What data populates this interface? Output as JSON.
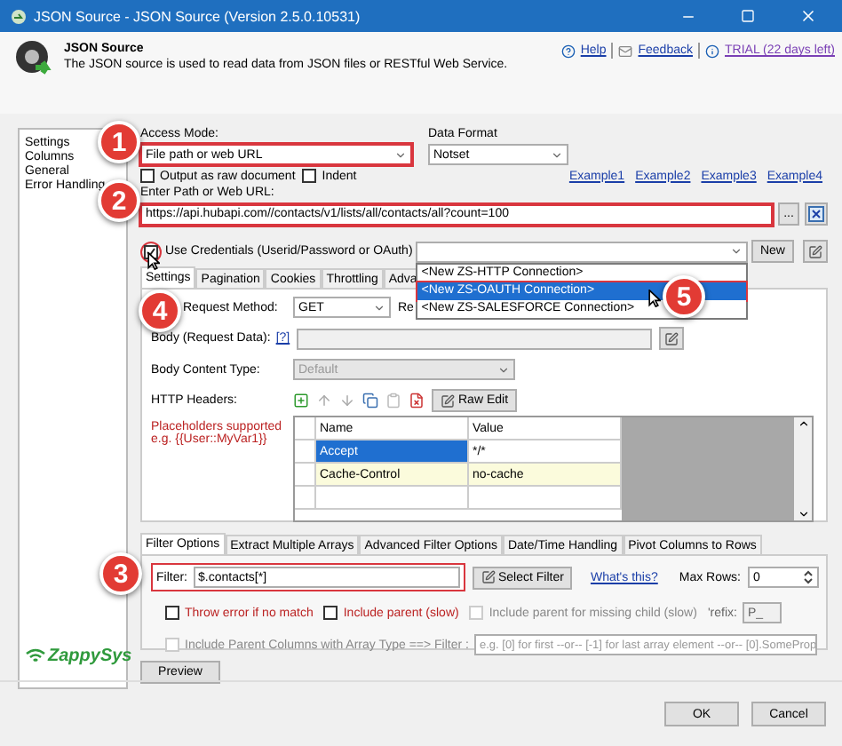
{
  "window": {
    "title": "JSON Source - JSON Source (Version 2.5.0.10531)"
  },
  "header": {
    "title": "JSON Source",
    "description": "The JSON source is used to read data from JSON files or RESTful Web Service.",
    "links": [
      {
        "label": "Help",
        "kind": "help"
      },
      {
        "label": "Feedback",
        "kind": "feedback"
      },
      {
        "label": "TRIAL (22 days left)",
        "kind": "trial"
      }
    ]
  },
  "sidebar": {
    "items": [
      "Settings",
      "Columns",
      "General",
      "Error Handling"
    ],
    "logo": "ZappySys"
  },
  "access_mode": {
    "label": "Access Mode:",
    "value": "File path or web URL",
    "highlighted": true
  },
  "data_format": {
    "label": "Data Format",
    "value": "Notset"
  },
  "options": [
    {
      "label": "Output as raw document",
      "checked": false
    },
    {
      "label": "Indent",
      "checked": false
    }
  ],
  "examples": [
    "Example1",
    "Example2",
    "Example3",
    "Example4"
  ],
  "url": {
    "label": "Enter Path or Web URL:",
    "value": "https://api.hubapi.com//contacts/v1/lists/all/contacts/all?count=100",
    "highlighted": true,
    "browse": "..."
  },
  "credentials": {
    "label": "Use Credentials (Userid/Password or OAuth)",
    "checked": true,
    "highlighted": true,
    "new_button": "New",
    "expanded": true,
    "options": [
      {
        "label": "<New ZS-HTTP Connection>",
        "selected": false
      },
      {
        "label": "<New ZS-OAUTH Connection>",
        "selected": true
      },
      {
        "label": "<New ZS-SALESFORCE Connection>",
        "selected": false
      }
    ]
  },
  "request_tabs": [
    {
      "label": "Settings",
      "selected": true
    },
    {
      "label": "Pagination",
      "selected": false
    },
    {
      "label": "Cookies",
      "selected": false
    },
    {
      "label": "Throttling",
      "selected": false
    },
    {
      "label": "Adva",
      "selected": false
    }
  ],
  "request": {
    "method_label": "Request Method:",
    "method": "GET",
    "cut_label": "Re",
    "body_label": "Body (Request Data):",
    "help": "[?]",
    "content_type_label": "Body Content Type:",
    "content_type": "Default",
    "headers_label": "HTTP Headers:",
    "raw_edit": "Raw Edit",
    "hint": "Placeholders supported e.g. {{User::MyVar1}}",
    "columns": [
      "Name",
      "Value"
    ],
    "rows": [
      {
        "name": "Accept",
        "value": "*/*",
        "selected": true
      },
      {
        "name": "Cache-Control",
        "value": "no-cache",
        "selected": false
      }
    ]
  },
  "filter_tabs": [
    {
      "label": "Filter Options",
      "selected": true
    },
    {
      "label": "Extract Multiple Arrays",
      "selected": false
    },
    {
      "label": "Advanced Filter Options",
      "selected": false
    },
    {
      "label": "Date/Time Handling",
      "selected": false
    },
    {
      "label": "Pivot Columns to Rows",
      "selected": false
    }
  ],
  "filter": {
    "label": "Filter:",
    "value": "$.contacts[*]",
    "highlighted": true,
    "select_button": "Select Filter",
    "help_link": "What's this?",
    "max_rows_label": "Max Rows:",
    "max_rows": "0"
  },
  "filter_options": [
    {
      "label": "Throw error if no match",
      "checked": false,
      "disabled": false
    },
    {
      "label": "Include parent (slow)",
      "checked": false,
      "disabled": false
    },
    {
      "label": "Include parent for missing child (slow)",
      "checked": false,
      "disabled": true
    }
  ],
  "prefix": {
    "label": "'refix:",
    "value": "P_"
  },
  "parent_columns": {
    "label": "Include Parent Columns with Array Type ==> Filter :",
    "checked": false,
    "disabled": true,
    "placeholder": "e.g. [0] for first --or-- [-1] for last array element --or-- [0].SomeProp"
  },
  "preview_button": "Preview",
  "buttons": [
    "OK",
    "Cancel"
  ],
  "callouts": [
    "1",
    "2",
    "3",
    "4",
    "5"
  ]
}
